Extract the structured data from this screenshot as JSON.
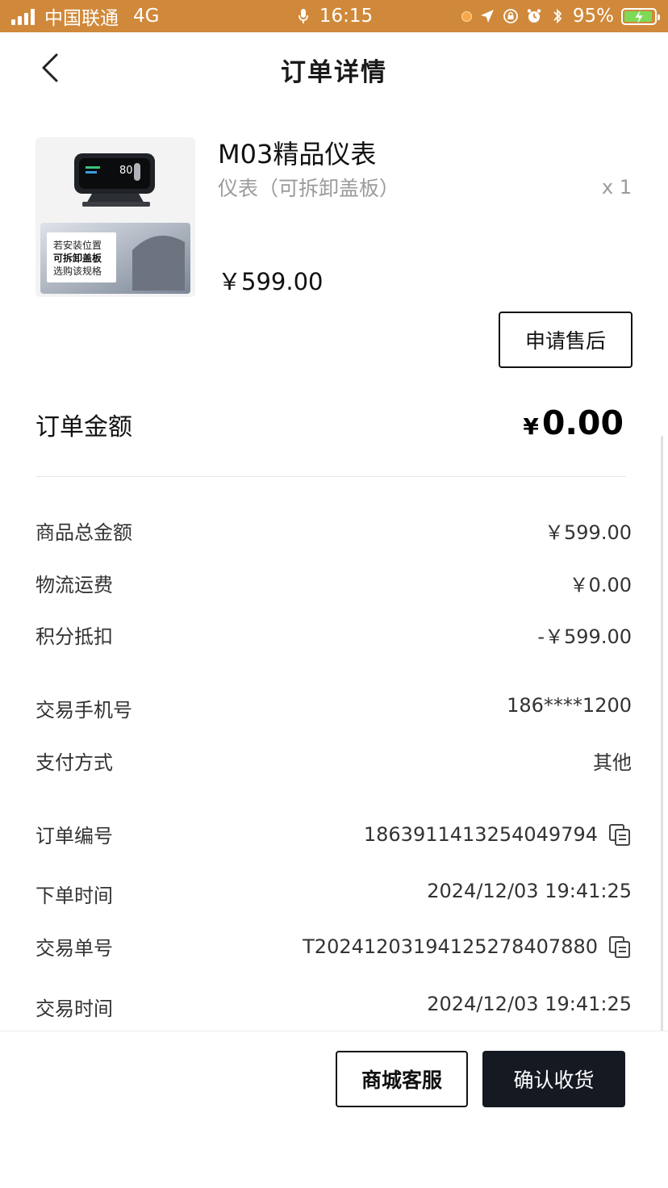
{
  "status_bar": {
    "carrier": "中国联通",
    "network": "4G",
    "time": "16:15",
    "battery": "95%"
  },
  "nav": {
    "title": "订单详情"
  },
  "product": {
    "name": "M03精品仪表",
    "spec": "仪表（可拆卸盖板）",
    "quantity": "x 1",
    "price": "￥599.00",
    "image_caption_line1": "若安装位置",
    "image_caption_line2": "可拆卸盖板",
    "image_caption_line3": "选购该规格",
    "image_screen_text": "80"
  },
  "after_sale_button": "申请售后",
  "order_amount": {
    "label": "订单金额",
    "currency": "¥",
    "value": "0.00"
  },
  "price_rows": [
    {
      "label": "商品总金额",
      "value": "￥599.00"
    },
    {
      "label": "物流运费",
      "value": "￥0.00"
    },
    {
      "label": "积分抵扣",
      "value": "-￥599.00"
    }
  ],
  "payment_rows": [
    {
      "label": "交易手机号",
      "value": "186****1200"
    },
    {
      "label": "支付方式",
      "value": "其他"
    }
  ],
  "order_rows": [
    {
      "label": "订单编号",
      "value": "1863911413254049794"
    },
    {
      "label": "下单时间",
      "value": "2024/12/03 19:41:25"
    },
    {
      "label": "交易单号",
      "value": "T20241203194125278407880"
    },
    {
      "label": "交易时间",
      "value": "2024/12/03 19:41:25"
    }
  ],
  "bottom_buttons": {
    "service": "商城客服",
    "confirm": "确认收货"
  },
  "colors": {
    "status_bar": "#d0893a",
    "primary_button": "#141922"
  }
}
